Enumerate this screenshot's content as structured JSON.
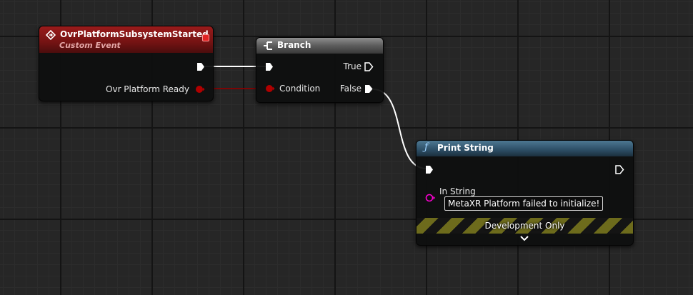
{
  "custom_event_node": {
    "title": "OvrPlatformSubsystemStarted",
    "subtitle": "Custom Event",
    "output_pin_label": "Ovr Platform Ready",
    "header_color": "#8b1a1a",
    "event_icon": "event-diamond-icon",
    "close_icon": "red-square-icon"
  },
  "branch_node": {
    "title": "Branch",
    "condition_label": "Condition",
    "true_label": "True",
    "false_label": "False",
    "header_color": "#6b6b6b",
    "icon": "branch-icon"
  },
  "print_node": {
    "title": "Print String",
    "in_string_label": "In String",
    "in_string_value": "MetaXR Platform failed to initialize!",
    "dev_only_label": "Development Only",
    "header_color": "#3b6079",
    "icon": "function-icon",
    "expand_icon": "chevron-down-icon"
  },
  "pin_colors": {
    "exec": "#ffffff",
    "bool": "#8c0000",
    "string": "#ff00d4"
  }
}
